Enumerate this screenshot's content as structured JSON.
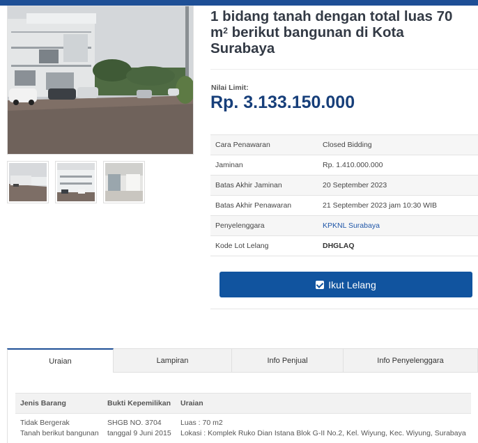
{
  "listing": {
    "title_line1": "1 bidang tanah dengan total luas 70",
    "title_unit": "m",
    "title_unit_sup": "2",
    "title_line2": " berikut bangunan di Kota",
    "title_line3": "Surabaya",
    "limit_label": "Nilai Limit:",
    "limit_value": "Rp. 3.133.150.000"
  },
  "info": [
    {
      "key": "Cara Penawaran",
      "value": "Closed Bidding"
    },
    {
      "key": "Jaminan",
      "value": "Rp. 1.410.000.000"
    },
    {
      "key": "Batas Akhir Jaminan",
      "value": "20 September 2023"
    },
    {
      "key": "Batas Akhir Penawaran",
      "value": "21 September 2023 jam 10:30 WIB"
    },
    {
      "key": "Penyelenggara",
      "value": "KPKNL Surabaya"
    },
    {
      "key": "Kode Lot Lelang",
      "value": "DHGLAQ"
    }
  ],
  "action": {
    "ikut_label": "Ikut Lelang"
  },
  "tabs": [
    "Uraian",
    "Lampiran",
    "Info Penjual",
    "Info Penyelenggara"
  ],
  "detail": {
    "headers": [
      "Jenis Barang",
      "Bukti Kepemilikan",
      "Uraian"
    ],
    "row": {
      "jenis_1": "Tidak Bergerak",
      "jenis_2": "Tanah berikut bangunan",
      "bukti_1": "SHGB NO. 3704",
      "bukti_2": "tanggal 9 Juni 2015",
      "uraian_1": "Luas : 70 m2",
      "uraian_2": "Lokasi : Komplek Ruko Dian Istana Blok G-II No.2, Kel. Wiyung, Kec. Wiyung, Surabaya"
    }
  },
  "colors": {
    "brand": "#1e4f96",
    "button": "#11549f",
    "price": "#173f7a",
    "link": "#1f56a8"
  }
}
